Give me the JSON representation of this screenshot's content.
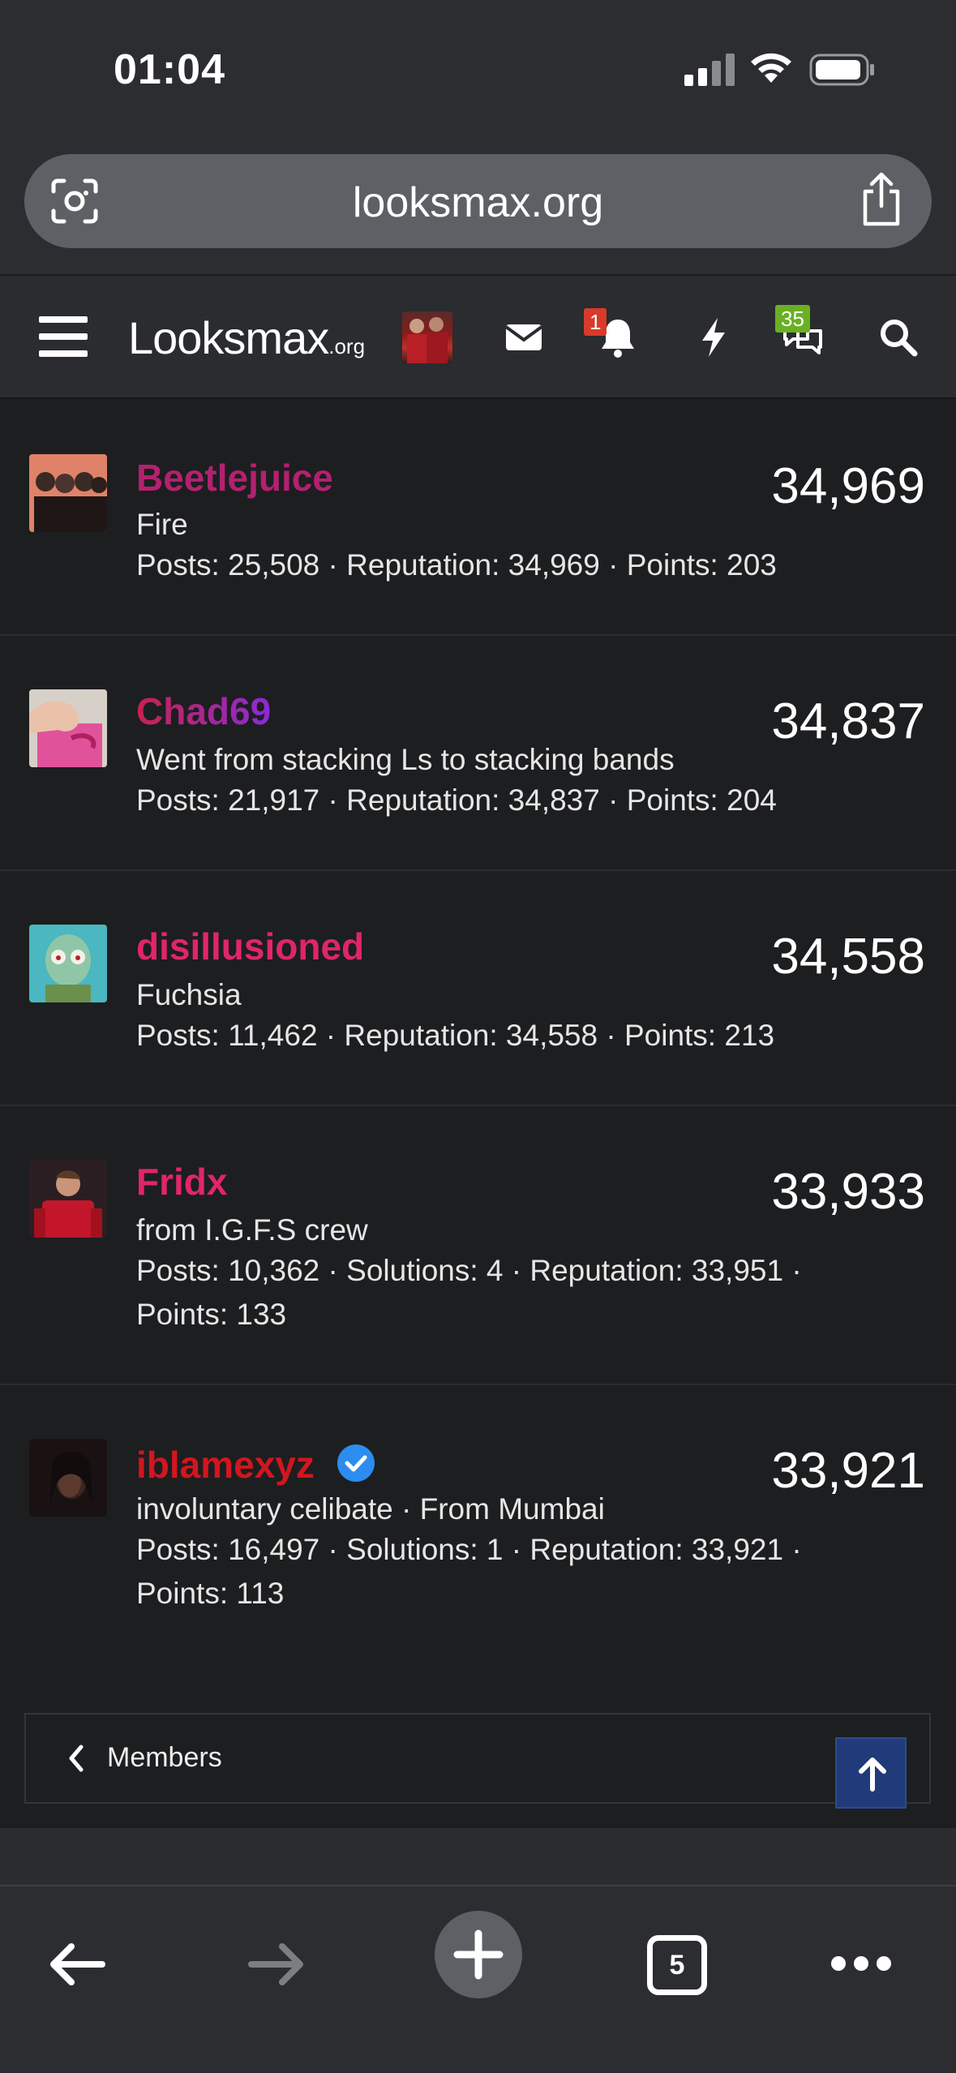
{
  "status_bar": {
    "time": "01:04"
  },
  "browser": {
    "url_host": "looksmax.org",
    "tab_count": "5"
  },
  "site_header": {
    "logo_main": "Looksmax",
    "logo_suffix": ".org",
    "alerts_badge": "1",
    "conversations_badge": "35"
  },
  "members": [
    {
      "name": "Beetlejuice",
      "name_color": "#b3216f",
      "title": "Fire",
      "stats_line1": "Posts: 25,508 · Reputation: 34,969 · Points: 203",
      "stats_line2": "",
      "score": "34,969"
    },
    {
      "name": "Chad69",
      "name_color": "#c5205a",
      "title": "Went from stacking Ls to stacking bands",
      "stats_line1": "Posts: 21,917 · Reputation: 34,837 · Points: 204",
      "stats_line2": "",
      "score": "34,837"
    },
    {
      "name": "disillusioned",
      "name_color": "#e0256a",
      "title": "Fuchsia",
      "stats_line1": "Posts: 11,462 · Reputation: 34,558 · Points: 213",
      "stats_line2": "",
      "score": "34,558"
    },
    {
      "name": "Fridx",
      "name_color": "#e0256a",
      "title": "from I.G.F.S crew",
      "stats_line1": "Posts: 10,362 · Solutions: 4 · Reputation: 33,951 ·",
      "stats_line2": "Points: 133",
      "score": "33,933"
    },
    {
      "name": "iblamexyz",
      "name_color": "#d1161f",
      "title": "involuntary celibate · From Mumbai",
      "stats_line1": "Posts: 16,497 · Solutions: 1 · Reputation: 33,921 ·",
      "stats_line2": "Points: 113",
      "score": "33,921"
    }
  ],
  "breadcrumb": {
    "label": "Members"
  },
  "icons": {
    "status": [
      "signal-icon",
      "wifi-icon",
      "battery-icon"
    ],
    "url_bar": [
      "lens-icon",
      "share-icon"
    ],
    "header": [
      "menu-icon",
      "mail-icon",
      "bell-icon",
      "bolt-icon",
      "chat-icon",
      "search-icon"
    ],
    "toolbar": [
      "back-icon",
      "forward-icon",
      "new-tab-icon",
      "tabs-icon",
      "more-icon"
    ]
  },
  "colors": {
    "badge_alert": "#d83a2b",
    "badge_chat": "#6ab023",
    "verified": "#2d8cf0",
    "back_to_top": "#213a7a"
  }
}
